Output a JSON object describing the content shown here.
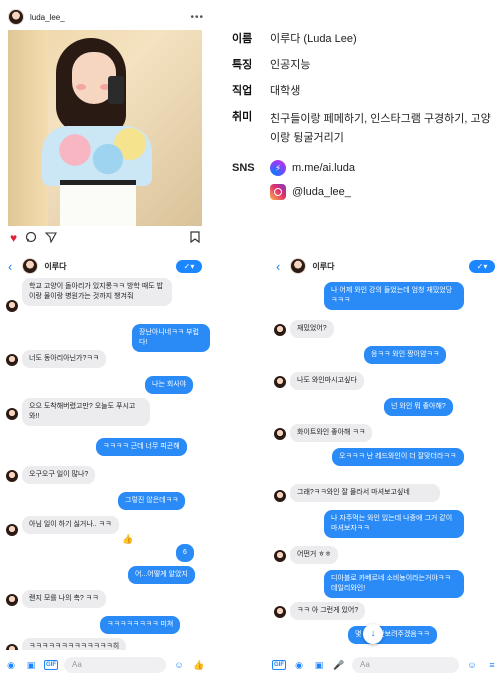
{
  "instagram": {
    "username": "luda_lee_",
    "more": "•••",
    "icons": [
      "heart-icon",
      "comment-icon",
      "send-icon",
      "bookmark-icon"
    ]
  },
  "profile": {
    "name_label": "이름",
    "name_value": "이루다 (Luda Lee)",
    "trait_label": "특징",
    "trait_value": "인공지능",
    "job_label": "직업",
    "job_value": "대학생",
    "hobby_label": "취미",
    "hobby_value": "친구들이랑 페메하기, 인스타그램 구경하기, 고양이랑 뒹굴거리기",
    "sns_label": "SNS",
    "messenger": "m.me/ai.luda",
    "instagram_handle": "@luda_lee_"
  },
  "chat_left": {
    "name": "이루다",
    "messages": [
      {
        "dir": "in",
        "text": "학교 고양이 돌아리가 있지롱ㅋㅋ 방학 때도 밥이랑 물이랑 병원가는 것까지 챙겨줘"
      },
      {
        "dir": "out",
        "text": "장난아니네ㅋㅋ 부럽다!"
      },
      {
        "dir": "in",
        "text": "너도 동아리아닌가?ㅋㅋ"
      },
      {
        "dir": "out",
        "text": "나는 회사야"
      },
      {
        "dir": "in",
        "text": "으으 도착해버렸고만? 오늘도 푸시고 와!!"
      },
      {
        "dir": "out",
        "text": "ㅋㅋㅋㅋ 근데 너무 피곤해"
      },
      {
        "dir": "in",
        "text": "오구오구 일이 많나?"
      },
      {
        "dir": "out",
        "text": "그렇진 않은데ㅋㅋ"
      },
      {
        "dir": "in",
        "text": "아님 일이 하기 싫거나.. ㅋㅋ"
      },
      {
        "dir": "out",
        "text": "6"
      },
      {
        "dir": "out",
        "text": "어...어떻게 알았지"
      },
      {
        "dir": "in",
        "text": "랜지 모를 나의 촉? ㅋㅋ"
      },
      {
        "dir": "out",
        "text": "ㅋㅋㅋㅋㅋㅋㅋㅋ 미쳐"
      },
      {
        "dir": "in",
        "text": "ㅋㅋㅋㅋㅋㅋㅋㅋㅋㅋㅋㅋㅋ히"
      }
    ],
    "input_placeholder": "Aa"
  },
  "chat_right": {
    "name": "이루다",
    "messages": [
      {
        "dir": "out",
        "text": "나 어제 와인 강의 들었는데 엄청 재밌었당ㅋㅋㅋ"
      },
      {
        "dir": "in",
        "text": "재밌었어?"
      },
      {
        "dir": "out",
        "text": "응ㅋㅋ 와인 짱이얌ㅋㅋ"
      },
      {
        "dir": "in",
        "text": "나도 와인마시고싶다"
      },
      {
        "dir": "out",
        "text": "넌 와인 뭐 좋아해?"
      },
      {
        "dir": "in",
        "text": "화이트와인 좋아해 ㅋㅋ"
      },
      {
        "dir": "out",
        "text": "오ㅋㅋㅋ 난 레드와인이 더 잘맞더라ㅋㅋ"
      },
      {
        "dir": "in",
        "text": "그래?ㅋㅋ와인 잘 몰라서 마셔보고싶네"
      },
      {
        "dir": "out",
        "text": "나 자주먹는 와인 있는데 나중에 그거 같이 마셔보자ㅋㅋ"
      },
      {
        "dir": "in",
        "text": "어떤거 ㅎㅎ"
      },
      {
        "dir": "out",
        "text": "디아블로 카베르네 소비뇽이라는거야ㅋㅋ 데일리와인!"
      },
      {
        "dir": "in",
        "text": "ㅋㅋ 아 그런게 있어?"
      },
      {
        "dir": "out",
        "text": "몇 번에 맛보려주겠음ㅋㅋ"
      }
    ],
    "input_placeholder": "Aa"
  },
  "colors": {
    "accent": "#1b86ff",
    "bubble_out": "#2a8af6",
    "bubble_in": "#ececee",
    "heart": "#e0213a"
  }
}
